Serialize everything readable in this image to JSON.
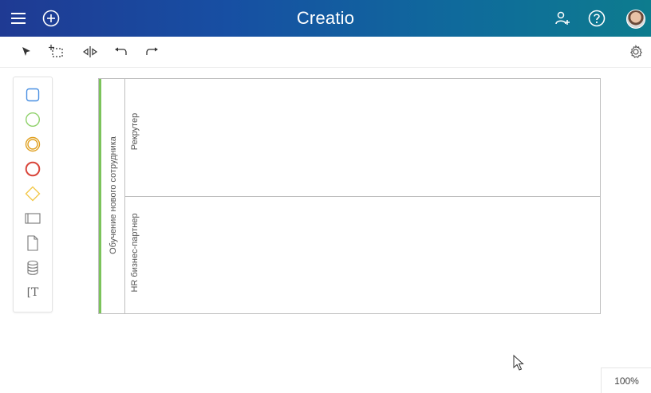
{
  "header": {
    "brand": "Creatio",
    "menu_icon": "hamburger-menu-icon",
    "add_icon": "plus-circle-icon",
    "user_icon": "add-user-icon",
    "help_icon": "help-icon",
    "avatar": "user-avatar"
  },
  "toolbar": {
    "tools": [
      "pointer-tool-icon",
      "lasso-select-icon",
      "move-space-icon",
      "undo-icon",
      "redo-icon"
    ],
    "settings_icon": "gear-icon"
  },
  "palette": {
    "items": [
      "task-icon",
      "start-event-icon",
      "intermediate-event-icon",
      "end-event-icon",
      "gateway-icon",
      "subprocess-icon",
      "data-object-icon",
      "data-store-icon",
      "text-annotation-icon"
    ],
    "annotation_glyph": "[T"
  },
  "diagram": {
    "pool_label": "Обучение нового сотрудника",
    "lanes": [
      "Рекрутер",
      "HR бизнес-партнер"
    ]
  },
  "zoom": {
    "level": "100%"
  },
  "colors": {
    "header_gradient_start": "#1f3a93",
    "header_gradient_end": "#0d7c8e",
    "pool_accent": "#7cc35b",
    "task_blue": "#4a90e2",
    "start_green": "#8fd16a",
    "intermediate_orange": "#e0a020",
    "end_red": "#d9463b",
    "gateway_yellow": "#f2c94c"
  }
}
